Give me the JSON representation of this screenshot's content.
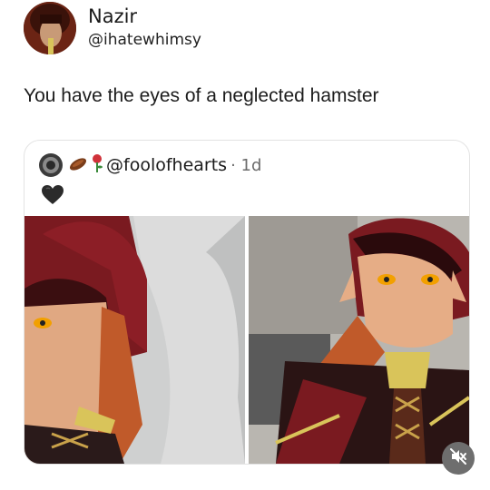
{
  "post": {
    "display_name": "Nazir",
    "handle": "@ihatewhimsy",
    "text": "You have the eyes of a neglected hamster"
  },
  "quoted": {
    "handle": "@foolofhearts",
    "time": "· 1d",
    "emojis": [
      "sausage-emoji",
      "rose-emoji"
    ],
    "heart_icon": "black-heart-icon"
  },
  "controls": {
    "mute_icon": "muted-speaker-icon"
  },
  "colors": {
    "card_border": "#e3e3e3",
    "mute_bg": "#6e6e6e"
  }
}
